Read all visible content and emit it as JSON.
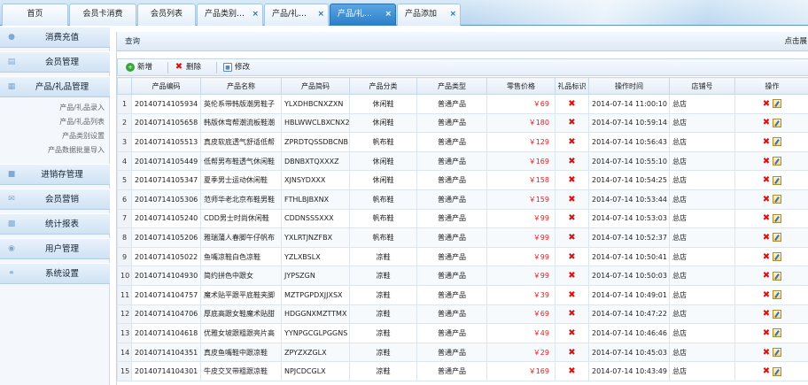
{
  "tabs": [
    {
      "label": "首页",
      "closable": false,
      "active": false
    },
    {
      "label": "会员卡消费",
      "closable": false,
      "active": false
    },
    {
      "label": "会员列表",
      "closable": false,
      "active": false
    },
    {
      "label": "产品类别…",
      "closable": true,
      "active": false
    },
    {
      "label": "产品/礼…",
      "closable": true,
      "active": false
    },
    {
      "label": "产品/礼…",
      "closable": true,
      "active": true
    },
    {
      "label": "产品添加",
      "closable": true,
      "active": false
    }
  ],
  "close_glyph": "×",
  "sidebar": {
    "menus": [
      {
        "label": "消费充值",
        "icon": "user-icon"
      },
      {
        "label": "会员管理",
        "icon": "card-icon"
      },
      {
        "label": "产品/礼品管理",
        "icon": "gift-icon"
      },
      {
        "label": "进销存管理",
        "icon": "box-icon"
      },
      {
        "label": "会员营销",
        "icon": "mail-icon"
      },
      {
        "label": "统计报表",
        "icon": "monitor-icon"
      },
      {
        "label": "用户管理",
        "icon": "lock-icon"
      },
      {
        "label": "系统设置",
        "icon": "link-icon"
      }
    ],
    "submenu": [
      "产品/礼品录入",
      "产品/礼品列表",
      "产品类别设置",
      "产品数据批量导入"
    ]
  },
  "main": {
    "header_title": "查询",
    "header_right": "点击展",
    "toolbar": {
      "add": "新增",
      "delete": "删除",
      "edit": "修改"
    }
  },
  "table": {
    "columns": [
      "",
      "产品编码",
      "产品名称",
      "产品简码",
      "产品分类",
      "产品类型",
      "零售价格",
      "礼品标识",
      "操作时间",
      "店铺号",
      "操作"
    ],
    "rows": [
      [
        "1",
        "20140714105934",
        "英伦系带韩版潮男鞋子",
        "YLXDHBCNXZXN",
        "休闲鞋",
        "普通产品",
        "￥69",
        "✖",
        "2014-07-14 11:00:10",
        "总店"
      ],
      [
        "2",
        "20140714105658",
        "韩版休弯帮潮流板鞋潮",
        "HBLWWCLBXCNX2",
        "休闲鞋",
        "普通产品",
        "￥180",
        "✖",
        "2014-07-14 10:59:14",
        "总店"
      ],
      [
        "3",
        "20140714105513",
        "真皮软底透气舒适低帮",
        "ZPRDTQSSDBCNB",
        "帆布鞋",
        "普通产品",
        "￥129",
        "✖",
        "2014-07-14 10:56:43",
        "总店"
      ],
      [
        "4",
        "20140714105449",
        "低帮男布鞋透气休闲鞋",
        "DBNBXTQXXXZ",
        "休闲鞋",
        "普通产品",
        "￥169",
        "✖",
        "2014-07-14 10:55:10",
        "总店"
      ],
      [
        "5",
        "20140714105347",
        "夏季男士运动休闲鞋",
        "XJNSYDXXX",
        "休闲鞋",
        "普通产品",
        "￥158",
        "✖",
        "2014-07-14 10:54:25",
        "总店"
      ],
      [
        "6",
        "20140714105306",
        "范师华老北京布鞋男鞋",
        "FTHLBJBXNX",
        "帆布鞋",
        "普通产品",
        "￥159",
        "✖",
        "2014-07-14 10:53:44",
        "总店"
      ],
      [
        "7",
        "20140714105240",
        "CDD男士时尚休闲鞋",
        "CDDNSSSXXX",
        "帆布鞋",
        "普通产品",
        "￥99",
        "✖",
        "2014-07-14 10:53:03",
        "总店"
      ],
      [
        "8",
        "20140714105206",
        "雅瑞蒲人春脚午仔帆布",
        "YXLRTJNZFBX",
        "帆布鞋",
        "普通产品",
        "￥99",
        "✖",
        "2014-07-14 10:52:37",
        "总店"
      ],
      [
        "9",
        "20140714105022",
        "鱼嘴凉鞋白色凉鞋",
        "YZLXBSLX",
        "凉鞋",
        "普通产品",
        "￥99",
        "✖",
        "2014-07-14 10:50:41",
        "总店"
      ],
      [
        "10",
        "20140714104930",
        "简约拼色中跟女",
        "JYPSZGN",
        "凉鞋",
        "普通产品",
        "￥99",
        "✖",
        "2014-07-14 10:50:03",
        "总店"
      ],
      [
        "11",
        "20140714104757",
        "魔术贴平跟平底鞋夹脚",
        "MZTPGPDXJJXSX",
        "凉鞋",
        "普通产品",
        "￥39",
        "✖",
        "2014-07-14 10:49:01",
        "总店"
      ],
      [
        "12",
        "20140714104706",
        "厚底高跟女鞋魔术贴甜",
        "HDGGNXMZTTMX",
        "凉鞋",
        "普通产品",
        "￥69",
        "✖",
        "2014-07-14 10:47:22",
        "总店"
      ],
      [
        "13",
        "20140714104618",
        "优雅女坡跟粗跟亮片高",
        "YYNPGCGLPGGNS",
        "凉鞋",
        "普通产品",
        "￥49",
        "✖",
        "2014-07-14 10:46:46",
        "总店"
      ],
      [
        "14",
        "20140714104351",
        "真皮鱼嘴鞋中跟凉鞋",
        "ZPYZXZGLX",
        "凉鞋",
        "普通产品",
        "￥29",
        "✖",
        "2014-07-14 10:45:03",
        "总店"
      ],
      [
        "15",
        "20140714104301",
        "牛皮交叉带粗跟凉鞋",
        "NPJCDCGLX",
        "凉鞋",
        "普通产品",
        "￥169",
        "✖",
        "2014-07-14 10:43:49",
        "总店"
      ]
    ]
  },
  "colors": {
    "accent": "#2a7dc8",
    "price": "#e02020",
    "delete": "#d11111"
  }
}
